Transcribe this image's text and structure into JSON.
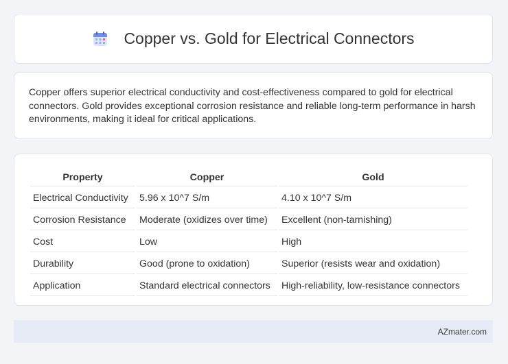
{
  "header": {
    "title": "Copper vs. Gold for Electrical Connectors",
    "icon": "calendar-icon"
  },
  "summary": {
    "text": "Copper offers superior electrical conductivity and cost-effectiveness compared to gold for electrical connectors. Gold provides exceptional corrosion resistance and reliable long-term performance in harsh environments, making it ideal for critical applications."
  },
  "table": {
    "headers": [
      "Property",
      "Copper",
      "Gold"
    ],
    "rows": [
      [
        "Electrical Conductivity",
        "5.96 x 10^7 S/m",
        "4.10 x 10^7 S/m"
      ],
      [
        "Corrosion Resistance",
        "Moderate (oxidizes over time)",
        "Excellent (non-tarnishing)"
      ],
      [
        "Cost",
        "Low",
        "High"
      ],
      [
        "Durability",
        "Good (prone to oxidation)",
        "Superior (resists wear and oxidation)"
      ],
      [
        "Application",
        "Standard electrical connectors",
        "High-reliability, low-resistance connectors"
      ]
    ]
  },
  "footer": {
    "text": "AZmater.com"
  },
  "colors": {
    "background": "#f3f4f8",
    "card": "#ffffff",
    "footer": "#e7ebf5",
    "icon_blue": "#6f8fe6",
    "icon_red": "#e36a6a"
  }
}
